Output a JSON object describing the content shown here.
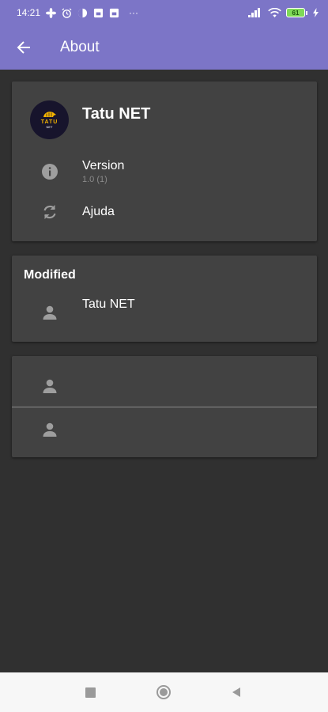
{
  "status_bar": {
    "time": "14:21",
    "more": "···",
    "battery": "61",
    "icons": [
      "fan-icon",
      "alarm-icon",
      "app-icon",
      "sim-icon",
      "sim-icon",
      "signal-icon",
      "wifi-icon",
      "battery-icon",
      "charging-icon"
    ]
  },
  "app_bar": {
    "title": "About",
    "back_icon": "arrow-back-icon",
    "color": "#7c75c7"
  },
  "app_info": {
    "logo_text": "TATU",
    "logo_subtext": "NET",
    "name": "Tatu NET",
    "version_label": "Version",
    "version_value": "1.0 (1)",
    "help_label": "Ajuda"
  },
  "modified": {
    "title": "Modified",
    "author": "Tatu NET"
  },
  "colors": {
    "background": "#303030",
    "card": "#424242",
    "secondary_text": "#8a8a8a"
  }
}
